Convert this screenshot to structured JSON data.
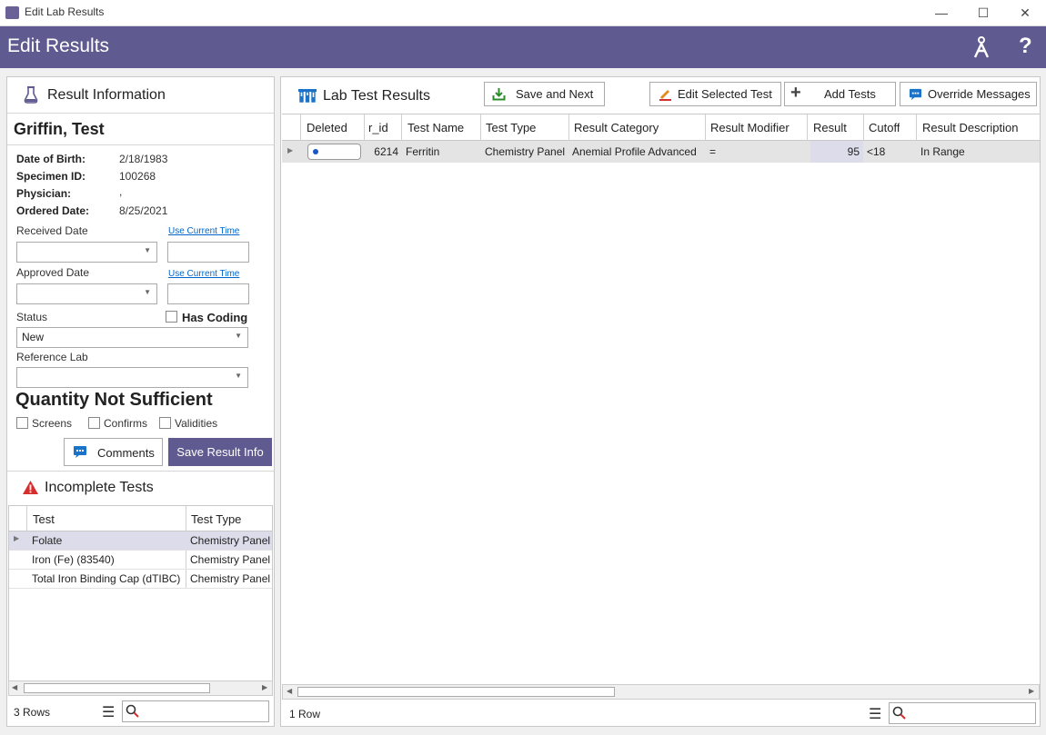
{
  "window": {
    "title": "Edit Lab Results",
    "minimize": "—",
    "maximize": "☐",
    "close": "✕"
  },
  "header": {
    "title": "Edit Results",
    "help": "?"
  },
  "left_panel": {
    "title": "Result Information",
    "patient_name": "Griffin, Test",
    "fields": [
      {
        "label": "Date of Birth:",
        "value": "2/18/1983"
      },
      {
        "label": "Specimen ID:",
        "value": "100268"
      },
      {
        "label": "Physician:",
        "value": ","
      },
      {
        "label": "Ordered Date:",
        "value": "8/25/2021"
      }
    ],
    "received_date_label": "Received Date",
    "approved_date_label": "Approved Date",
    "use_current_time": "Use Current Time",
    "status_label": "Status",
    "status_value": "New",
    "has_coding_label": "Has Coding",
    "reference_lab_label": "Reference Lab",
    "reference_lab_value": "",
    "qns_title": "Quantity Not Sufficient",
    "qns_options": [
      "Screens",
      "Confirms",
      "Validities"
    ],
    "comments_button": "Comments",
    "save_button": "Save Result Info"
  },
  "incomplete_tests": {
    "title": "Incomplete Tests",
    "columns": [
      "Test",
      "Test Type"
    ],
    "rows": [
      {
        "test": "Folate",
        "type": "Chemistry Panel"
      },
      {
        "test": "Iron (Fe) (83540)",
        "type": "Chemistry Panel"
      },
      {
        "test": "Total Iron Binding Cap (dTIBC)",
        "type": "Chemistry Panel"
      }
    ],
    "row_count": "3 Rows"
  },
  "lab_results": {
    "title": "Lab Test Results",
    "toolbar": {
      "save_next": "Save and Next",
      "edit_selected": "Edit Selected Test",
      "add_tests": "Add Tests",
      "override": "Override Messages"
    },
    "columns": [
      "Deleted",
      "r_id",
      "Test Name",
      "Test Type",
      "Result Category",
      "Result Modifier",
      "Result",
      "Cutoff",
      "Result Description"
    ],
    "rows": [
      {
        "deleted": "",
        "r_id": "6214",
        "test_name": "Ferritin",
        "test_type": "Chemistry Panel",
        "result_category": "Anemial Profile Advanced",
        "result_modifier": "=",
        "result": "95",
        "cutoff": "<18",
        "result_description": "In Range"
      }
    ],
    "row_count": "1 Row"
  },
  "colors": {
    "accent": "#5f5a8f",
    "warning": "#d62d2d",
    "link": "#0066cc"
  }
}
